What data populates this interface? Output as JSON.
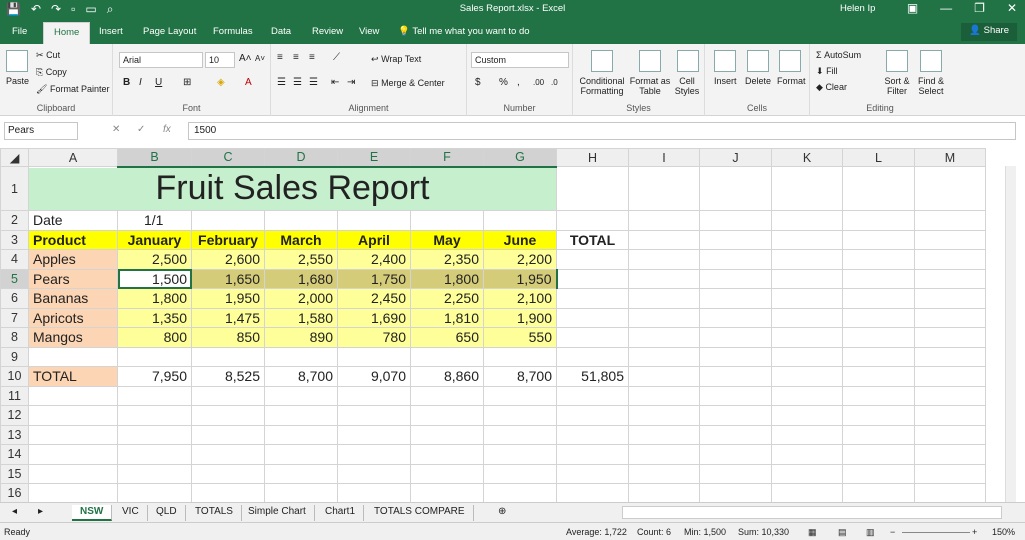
{
  "window": {
    "title": "Sales Report.xlsx - Excel",
    "user": "Helen Ip"
  },
  "ribbon_tabs": [
    "File",
    "Home",
    "Insert",
    "Page Layout",
    "Formulas",
    "Data",
    "Review",
    "View"
  ],
  "tell_me": "Tell me what you want to do",
  "share_label": "Share",
  "ribbon": {
    "clipboard": {
      "paste": "Paste",
      "cut": "Cut",
      "copy": "Copy",
      "format_painter": "Format Painter",
      "label": "Clipboard"
    },
    "font": {
      "name": "Arial",
      "size": "10",
      "label": "Font"
    },
    "alignment": {
      "wrap": "Wrap Text",
      "merge": "Merge & Center",
      "label": "Alignment"
    },
    "number": {
      "format": "Custom",
      "label": "Number"
    },
    "styles": {
      "conditional": "Conditional Formatting",
      "format_table": "Format as Table",
      "cell_styles": "Cell Styles",
      "label": "Styles"
    },
    "cells": {
      "insert": "Insert",
      "delete": "Delete",
      "format": "Format",
      "label": "Cells"
    },
    "editing": {
      "autosum": "AutoSum",
      "fill": "Fill",
      "clear": "Clear",
      "sort": "Sort & Filter",
      "find": "Find & Select",
      "label": "Editing"
    }
  },
  "formula_bar": {
    "name_box": "Pears",
    "value": "1500"
  },
  "columns": [
    "A",
    "B",
    "C",
    "D",
    "E",
    "F",
    "G",
    "H",
    "I",
    "J",
    "K",
    "L",
    "M"
  ],
  "sheet": {
    "title": "Fruit Sales Report",
    "date_label": "Date",
    "date_value": "1/1",
    "headers": [
      "Product",
      "January",
      "February",
      "March",
      "April",
      "May",
      "June",
      "TOTAL"
    ],
    "rows": [
      {
        "product": "Apples",
        "values": [
          "2,500",
          "2,600",
          "2,550",
          "2,400",
          "2,350",
          "2,200"
        ]
      },
      {
        "product": "Pears",
        "values": [
          "1,500",
          "1,650",
          "1,680",
          "1,750",
          "1,800",
          "1,950"
        ]
      },
      {
        "product": "Bananas",
        "values": [
          "1,800",
          "1,950",
          "2,000",
          "2,450",
          "2,250",
          "2,100"
        ]
      },
      {
        "product": "Apricots",
        "values": [
          "1,350",
          "1,475",
          "1,580",
          "1,690",
          "1,810",
          "1,900"
        ]
      },
      {
        "product": "Mangos",
        "values": [
          "800",
          "850",
          "890",
          "780",
          "650",
          "550"
        ]
      }
    ],
    "total_label": "TOTAL",
    "totals": [
      "7,950",
      "8,525",
      "8,700",
      "9,070",
      "8,860",
      "8,700"
    ],
    "grand_total": "51,805"
  },
  "row_numbers": [
    "1",
    "2",
    "3",
    "4",
    "5",
    "6",
    "7",
    "8",
    "9",
    "10",
    "11",
    "12",
    "13",
    "14",
    "15",
    "16"
  ],
  "sheet_tabs": [
    "NSW",
    "VIC",
    "QLD",
    "TOTALS",
    "Simple Chart",
    "Chart1",
    "TOTALS COMPARE"
  ],
  "status": {
    "ready": "Ready",
    "average": "Average: 1,722",
    "count": "Count: 6",
    "min": "Min: 1,500",
    "sum": "Sum: 10,330",
    "zoom": "150%"
  }
}
